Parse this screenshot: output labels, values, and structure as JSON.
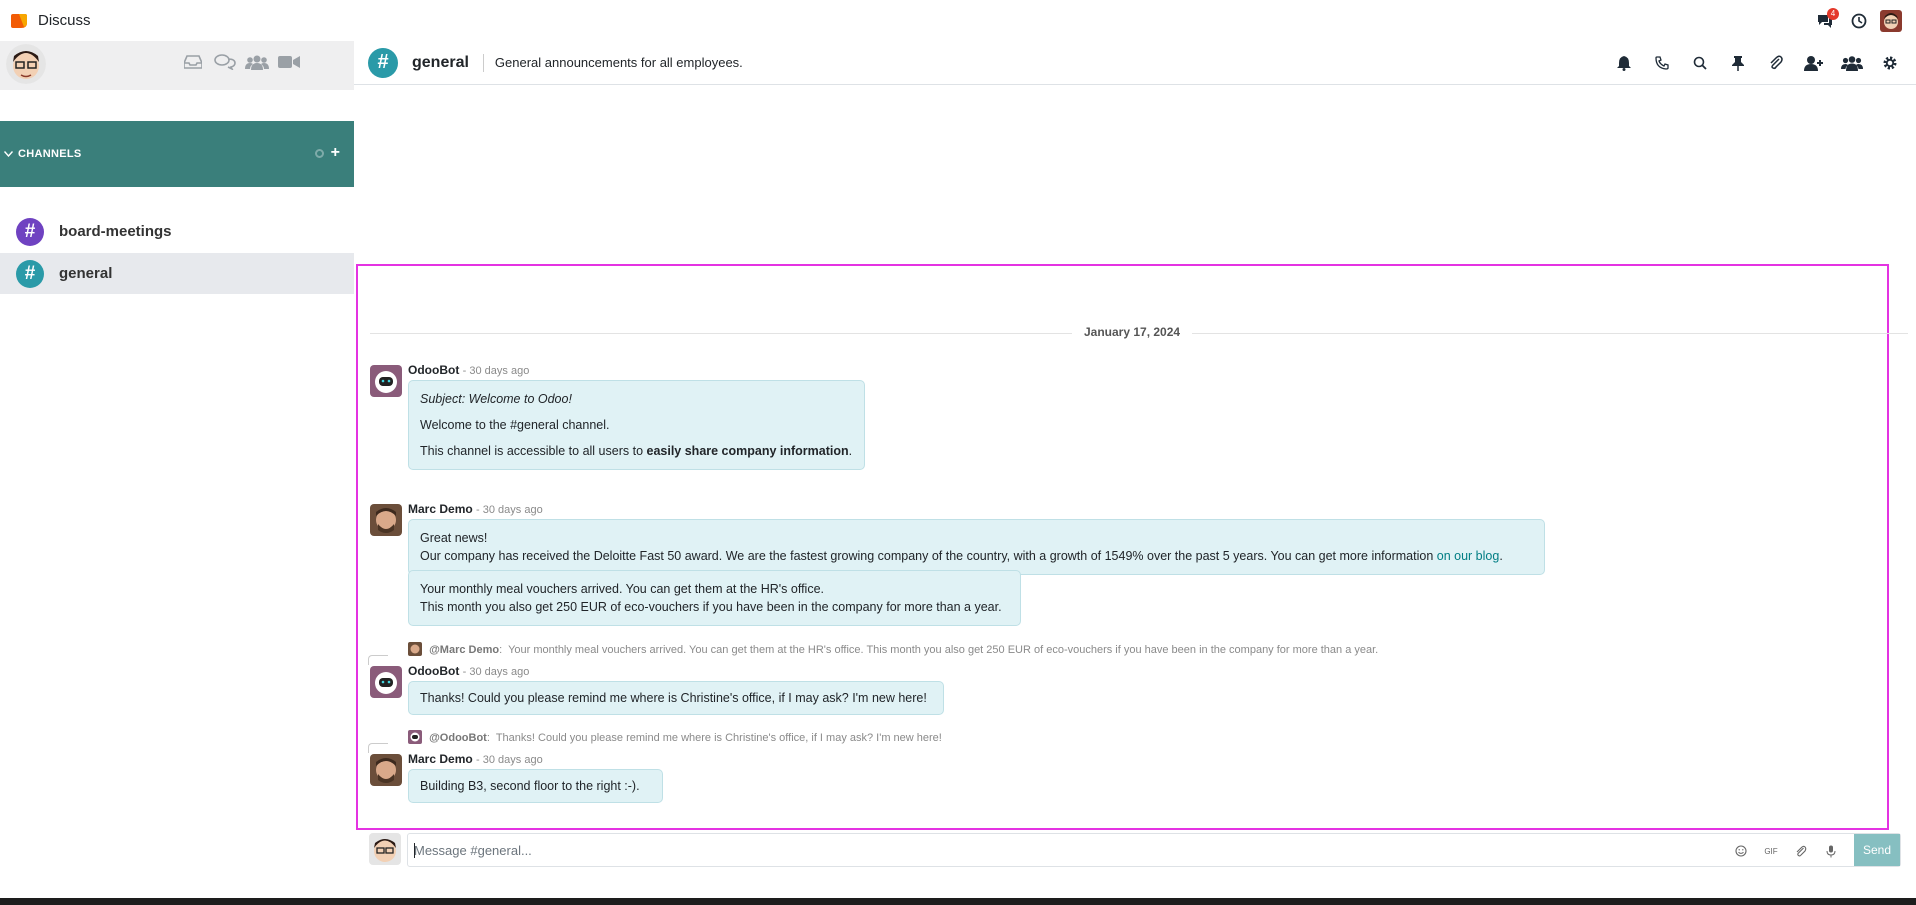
{
  "app": {
    "title": "Discuss"
  },
  "topbar": {
    "chat_badge": "4"
  },
  "sidebar": {
    "channels_header": "CHANNELS",
    "channels": [
      {
        "name": "board-meetings",
        "color": "#6f42c1"
      },
      {
        "name": "general",
        "color": "#2a9aa8"
      }
    ]
  },
  "thread": {
    "name": "general",
    "description": "General announcements for all employees."
  },
  "date_separator": "January 17, 2024",
  "messages": [
    {
      "author": "OdooBot",
      "when": "- 30 days ago",
      "subject": "Subject: Welcome to Odoo!",
      "line1": "Welcome to the #general channel.",
      "line2_pre": "This channel is accessible to all users to ",
      "line2_bold": "easily share company information",
      "line2_post": "."
    },
    {
      "author": "Marc Demo",
      "when": "- 30 days ago",
      "b1_line1": "Great news!",
      "b1_line2_pre": "Our company has received the Deloitte Fast 50 award. We are the fastest growing company of the country, with a growth of 1549% over the past 5 years. You can get more information ",
      "b1_link": "on our blog",
      "b1_line2_post": ".",
      "b2_line1": "Your monthly meal vouchers arrived. You can get them at the HR's office.",
      "b2_line2": "This month you also get 250 EUR of eco-vouchers if you have been in the company for more than a year."
    },
    {
      "reply_to": "@Marc Demo",
      "reply_text": "Your monthly meal vouchers arrived. You can get them at the HR's office. This month you also get 250 EUR of eco-vouchers if you have been in the company for more than a year.",
      "author": "OdooBot",
      "when": "- 30 days ago",
      "text": "Thanks! Could you please remind me where is Christine's office, if I may ask? I'm new here!"
    },
    {
      "reply_to": "@OdooBot",
      "reply_text": "Thanks! Could you please remind me where is Christine's office, if I may ask? I'm new here!",
      "author": "Marc Demo",
      "when": "- 30 days ago",
      "text": "Building B3, second floor to the right :-)."
    }
  ],
  "composer": {
    "placeholder": "Message #general...",
    "gif_label": "GIF",
    "send_label": "Send"
  },
  "colors": {
    "accent": "#3a7f7b",
    "bubble": "#e0f2f5",
    "highlight_border": "#e433e2"
  }
}
